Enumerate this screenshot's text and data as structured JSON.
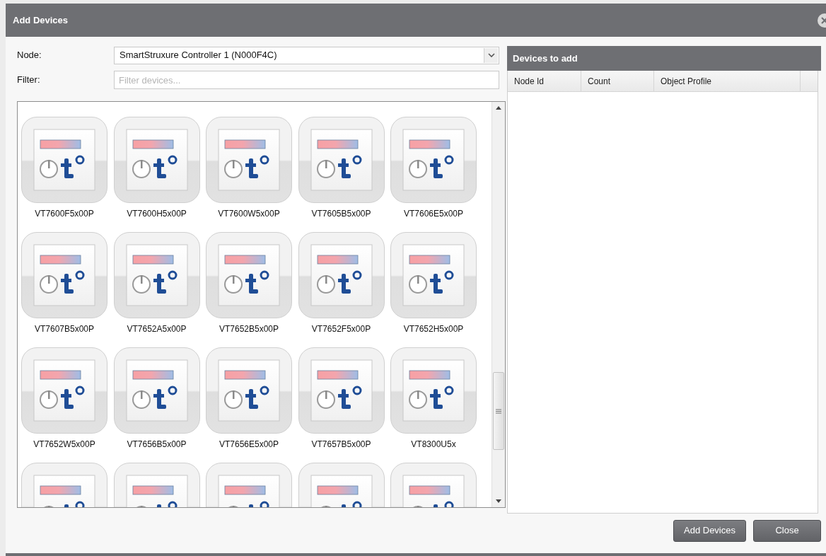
{
  "window": {
    "title": "Add Devices"
  },
  "node": {
    "label": "Node:",
    "value": "SmartStruxure Controller 1 (N000F4C)"
  },
  "filter": {
    "label": "Filter:",
    "placeholder": "Filter devices..."
  },
  "devices": [
    {
      "kind": "device",
      "label": "VT7600F5x00P"
    },
    {
      "kind": "device",
      "label": "VT7600H5x00P"
    },
    {
      "kind": "device",
      "label": "VT7600W5x00P"
    },
    {
      "kind": "device",
      "label": "VT7605B5x00P"
    },
    {
      "kind": "device",
      "label": "VT7606E5x00P"
    },
    {
      "kind": "device",
      "label": "VT7607B5x00P"
    },
    {
      "kind": "device",
      "label": "VT7652A5x00P"
    },
    {
      "kind": "device",
      "label": "VT7652B5x00P"
    },
    {
      "kind": "device",
      "label": "VT7652F5x00P"
    },
    {
      "kind": "device",
      "label": "VT7652H5x00P"
    },
    {
      "kind": "device",
      "label": "VT7652W5x00P"
    },
    {
      "kind": "device",
      "label": "VT7656B5x00P"
    },
    {
      "kind": "device",
      "label": "VT7656E5x00P"
    },
    {
      "kind": "device",
      "label": "VT7657B5x00P"
    },
    {
      "kind": "device",
      "label": "VT8300U5x"
    },
    {
      "kind": "cut_off"
    },
    {
      "kind": "cut_off"
    },
    {
      "kind": "cut_off"
    },
    {
      "kind": "cut_off"
    },
    {
      "kind": "cut_off"
    }
  ],
  "devices_to_add": {
    "title": "Devices to add",
    "columns": [
      "Node Id",
      "Count",
      "Object Profile"
    ]
  },
  "buttons": [
    "Add Devices",
    "Close"
  ]
}
